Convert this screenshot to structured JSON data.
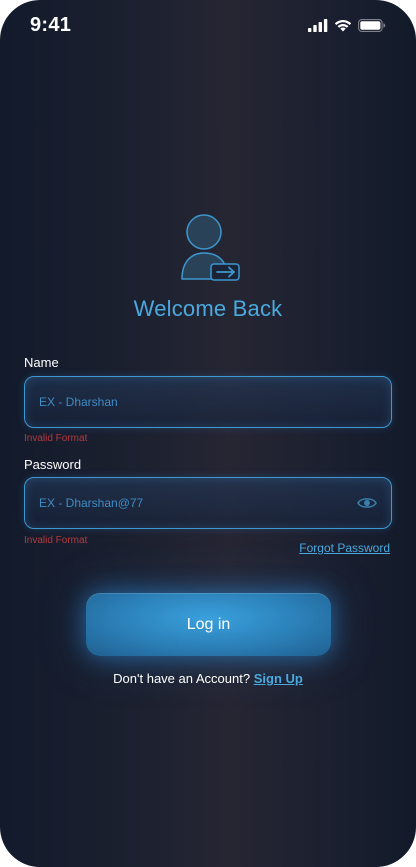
{
  "status_bar": {
    "time": "9:41"
  },
  "icons": {
    "signal": "cellular-signal-icon",
    "wifi": "wifi-icon",
    "battery": "battery-icon",
    "avatar": "user-login-icon",
    "eye": "eye-icon"
  },
  "colors": {
    "accent": "#4aa9de",
    "error": "#b43a3f",
    "border": "#3d97d0"
  },
  "header": {
    "title": "Welcome Back"
  },
  "form": {
    "name": {
      "label": "Name",
      "placeholder": "EX - Dharshan",
      "value": "",
      "error": "Invalid Format"
    },
    "password": {
      "label": "Password",
      "placeholder": "EX - Dharshan@77",
      "value": "",
      "error": "Invalid Format"
    },
    "forgot_label": "Forgot Password",
    "login_label": "Log in"
  },
  "footer": {
    "prompt": "Don't have an Account?",
    "signup_label": "Sign Up"
  }
}
